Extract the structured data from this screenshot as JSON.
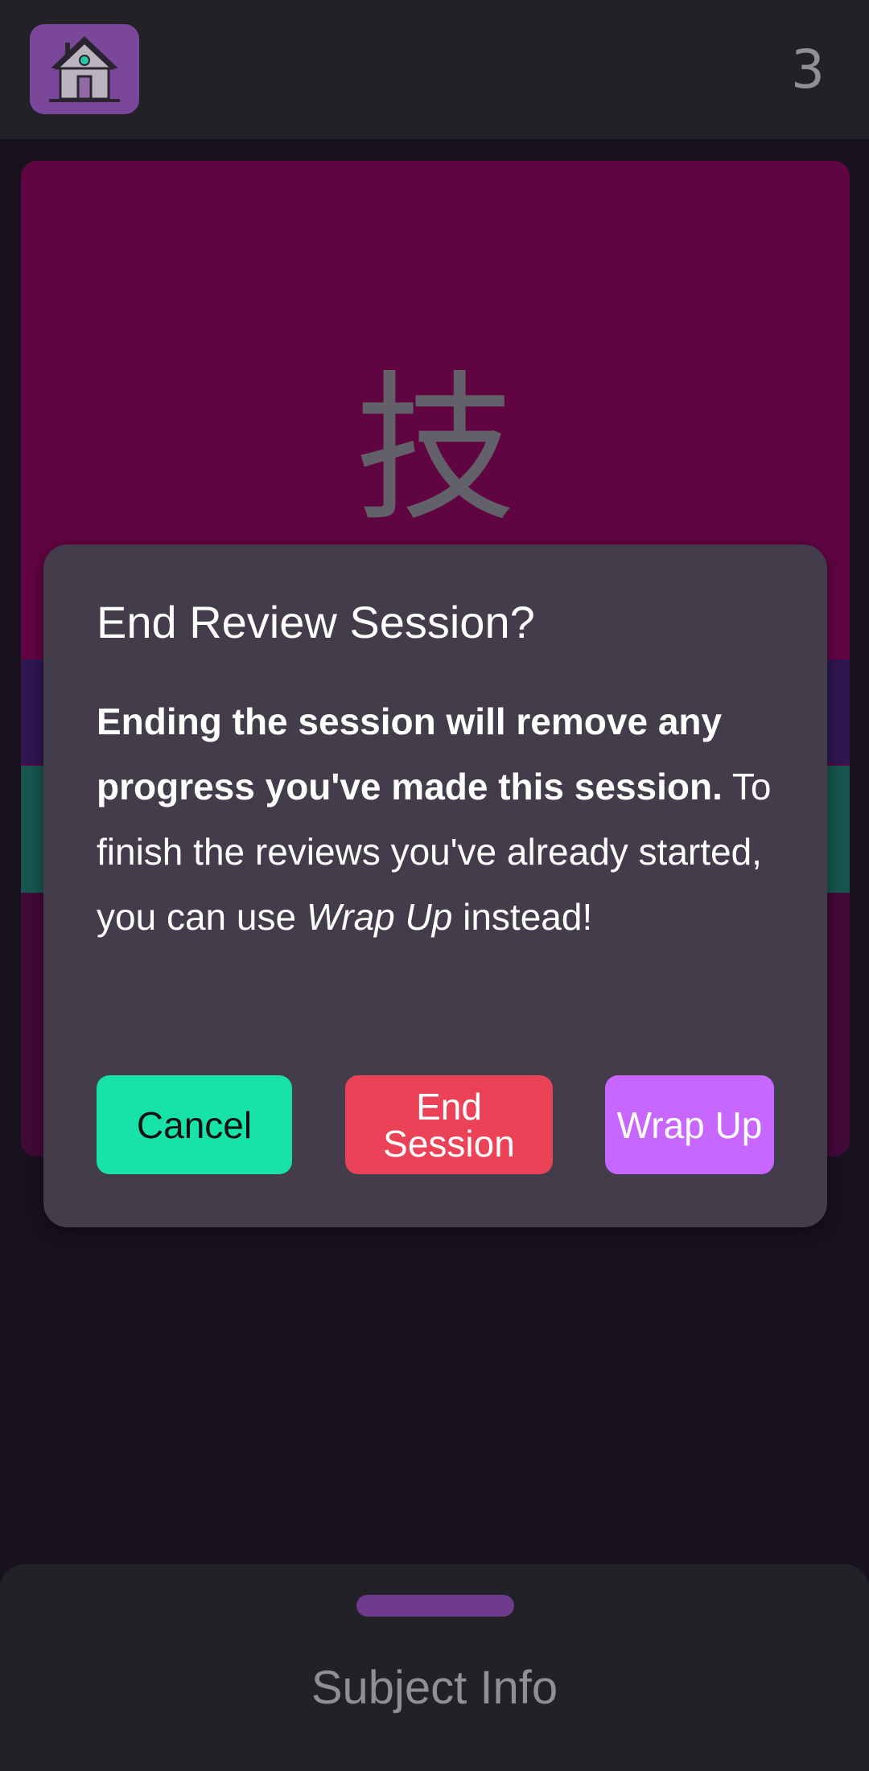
{
  "header": {
    "count": "3"
  },
  "card": {
    "kanji": "技"
  },
  "dialog": {
    "title": "End Review Session?",
    "body_bold": "Ending the session will remove any progress you've made this session.",
    "body_text": " To finish the reviews you've already started, you can use ",
    "body_italic": "Wrap Up",
    "body_tail": " instead!",
    "buttons": {
      "cancel": "Cancel",
      "end_session": "End Session",
      "wrap_up": "Wrap Up"
    }
  },
  "sheet": {
    "title": "Subject Info"
  },
  "colors": {
    "card": "#8a0057",
    "cancel": "#17e3a8",
    "end_session": "#ec4257",
    "wrap_up": "#c867ff"
  }
}
